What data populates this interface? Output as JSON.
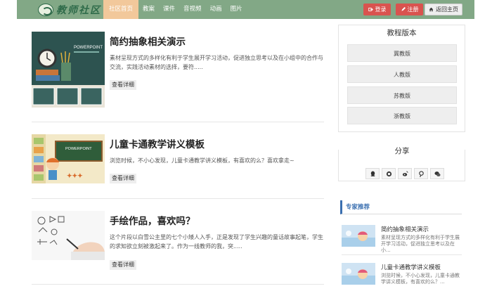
{
  "header": {
    "logo_text": "教师社区",
    "nav": [
      {
        "label": "社区首页",
        "active": true
      },
      {
        "label": "教案",
        "active": false
      },
      {
        "label": "课件",
        "active": false
      },
      {
        "label": "音视频",
        "active": false
      },
      {
        "label": "动画",
        "active": false
      },
      {
        "label": "图片",
        "active": false
      }
    ],
    "login_label": "登录",
    "register_label": "注册",
    "home_label": "返回主页"
  },
  "articles": [
    {
      "title": "简约抽象相关演示",
      "desc": "素材呈现方式的多样化有利于学生展开学习活动，促进独立思考以及在小组中的合作与交流，实践活动素材的选择，要符.....",
      "more": "查看详细",
      "thumb_text": "POWERPOINT"
    },
    {
      "title": "儿童卡通教学讲义模板",
      "desc": "浏览时候，不小心发现，儿童卡通教学讲义模板，有喜欢的么？喜欢拿走~",
      "more": "查看详细",
      "thumb_text": "POWERPOINT"
    },
    {
      "title": "手绘作品，喜欢吗？",
      "desc": "这个片段以白雪公主里的七个小矮人入手，正是发现了学生兴趣的童话故事起笔，学生的求知欲立刻被激起来了。作为一线教师的我，突.....",
      "more": "查看详细"
    }
  ],
  "sidebar": {
    "versions_title": "教程版本",
    "versions": [
      "冀教版",
      "人教版",
      "苏教版",
      "浙教版"
    ],
    "share_title": "分享",
    "share_icons": [
      "qq-icon",
      "github-icon",
      "weibo-icon",
      "tencent-weibo-icon",
      "wechat-icon"
    ],
    "expert_title": "专家推荐",
    "experts": [
      {
        "title": "简约抽象相关演示",
        "desc": "素材呈现方式的多样化有利于学生展开学习活动，促进独立思考以及在小..."
      },
      {
        "title": "儿童卡通教学讲义模板",
        "desc": "浏览时候，不小心发现，儿童卡通教学讲义模板，有喜欢的么？..."
      }
    ]
  },
  "colors": {
    "topbar": "#82a886",
    "nav_active": "#f2c89b",
    "button_red": "#d9534f",
    "expert_blue": "#3a6fb0"
  }
}
